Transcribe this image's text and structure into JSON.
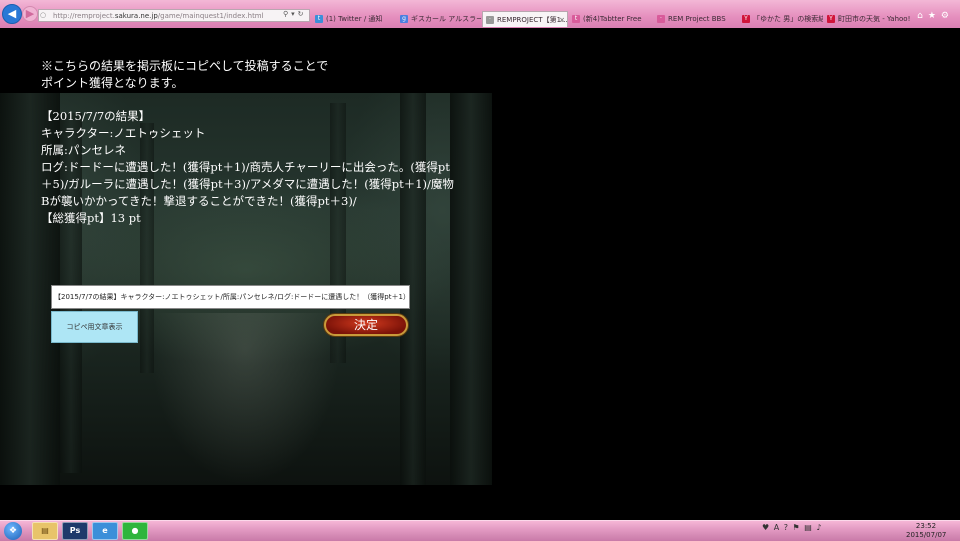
{
  "browser": {
    "url_prefix": "http://remproject.",
    "url_host": "sakura.ne.jp",
    "url_path": "/game/mainquest1/index.html",
    "tabs": [
      {
        "label": "(1) Twitter / 通知",
        "icon": "twitter-icon"
      },
      {
        "label": "ギスカール アルスラー...",
        "icon": "google-icon"
      },
      {
        "label": "REMPROJECT【第1...",
        "icon": "page-icon",
        "active": true
      },
      {
        "label": "(新4)Tabtter Free",
        "icon": "tabtter-icon"
      },
      {
        "label": "REM Project BBS",
        "icon": "page-icon"
      },
      {
        "label": "「ゆかた 男」の検索結...",
        "icon": "yahoo-icon"
      },
      {
        "label": "町田市の天気 - Yahoo!...",
        "icon": "yahoo-icon"
      }
    ]
  },
  "page": {
    "notice_line1": "※こちらの結果を掲示板にコピペして投稿することで",
    "notice_line2": "ポイント獲得となります。",
    "result_header": "【2015/7/7の結果】",
    "character": "キャラクター:ノエトゥシェット",
    "affiliation": "所属:パンセレネ",
    "log": "ログ:ドードーに遭遇した！(獲得pt＋1)/商売人チャーリーに出会った。(獲得pt＋5)/ガルーラに遭遇した！(獲得pt＋3)/アメダマに遭遇した！(獲得pt＋1)/魔物Bが襲いかかってきた！撃退することができた！(獲得pt＋3)/",
    "total": "【総獲得pt】13 pt",
    "copy_text": "【2015/7/7の結果】キャラクター:ノエトゥシェット/所属:パンセレネ/ログ:ドードーに遭遇した！（獲得pt＋1）/商売人チャーリーに出会った。",
    "copy_button": "コピペ用文章表示",
    "decide_button": "決定"
  },
  "taskbar": {
    "apps": [
      "explorer",
      "photoshop",
      "internet-explorer",
      "line"
    ],
    "clock_time": "23:52",
    "clock_date": "2015/07/07"
  }
}
